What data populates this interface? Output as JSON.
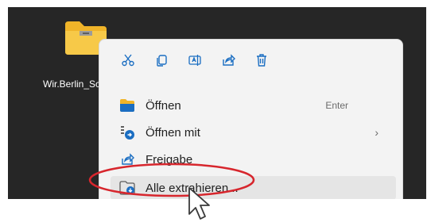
{
  "desktop": {
    "file": {
      "label": "Wir.Berlin_Sch",
      "icon": "zip-folder-icon"
    }
  },
  "context_menu": {
    "quick_actions": [
      {
        "name": "cut",
        "icon": "scissors-icon"
      },
      {
        "name": "copy",
        "icon": "copy-icon"
      },
      {
        "name": "rename",
        "icon": "rename-icon"
      },
      {
        "name": "share",
        "icon": "share-icon"
      },
      {
        "name": "delete",
        "icon": "trash-icon"
      }
    ],
    "items": [
      {
        "label": "Öffnen",
        "shortcut": "Enter",
        "icon": "folder-open-icon"
      },
      {
        "label": "Öffnen mit",
        "has_submenu": true,
        "icon": "open-with-icon"
      },
      {
        "label": "Freigabe",
        "icon": "share-icon"
      },
      {
        "label": "Alle extrahieren...",
        "icon": "extract-icon"
      }
    ],
    "submenu_chevron": "›"
  },
  "colors": {
    "desktop_bg": "#262626",
    "menu_bg": "#f3f3f3",
    "accent_blue": "#1b6ec2",
    "annotation_red": "#d7262d"
  }
}
